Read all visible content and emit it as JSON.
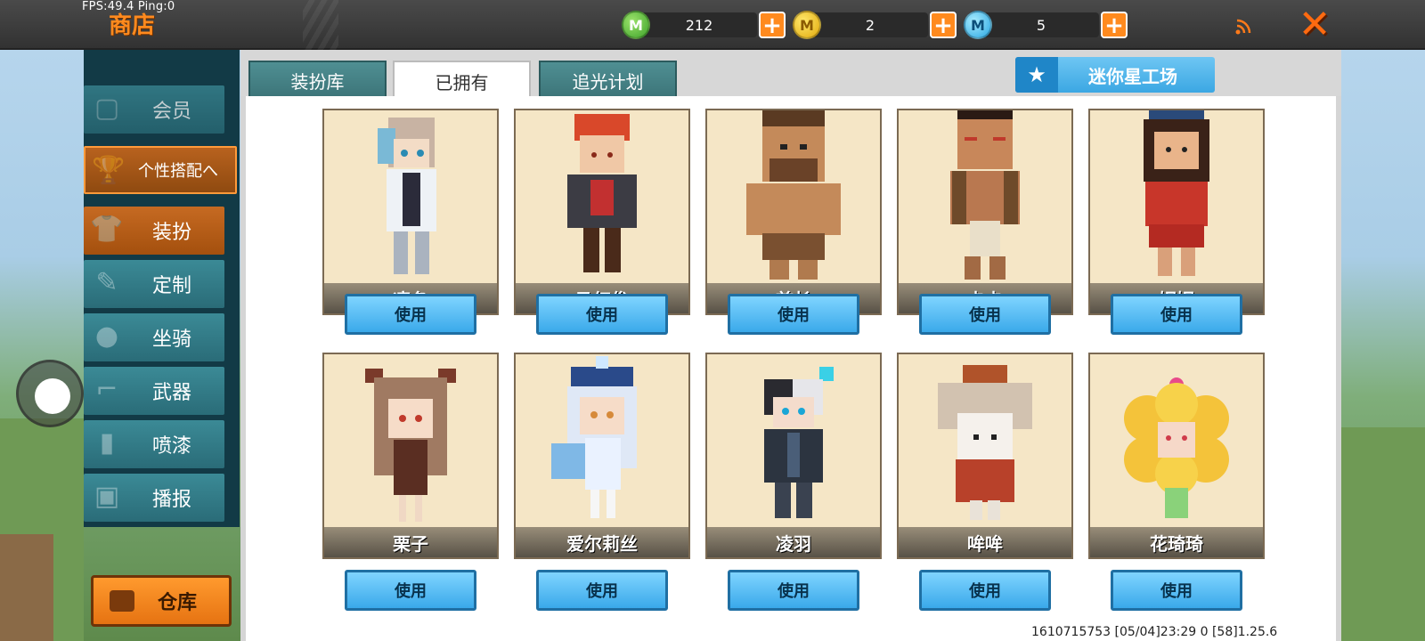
{
  "status": {
    "fps": "FPS:49.4",
    "ping": "Ping:0"
  },
  "header": {
    "title": "商店"
  },
  "currencies": [
    {
      "icon": "green-mini-coin-icon",
      "symbol": "M",
      "amount": "212"
    },
    {
      "icon": "gold-coin-icon",
      "symbol": "M",
      "amount": "2"
    },
    {
      "icon": "blue-mini-bean-icon",
      "symbol": "M",
      "amount": "5"
    }
  ],
  "plus_label": "+",
  "close_label": "✕",
  "sidebar": {
    "items": [
      {
        "label": "会员",
        "icon": "member-icon"
      },
      {
        "label": "个性搭配へ",
        "icon": "trophy-icon"
      },
      {
        "label": "装扮",
        "icon": "shirt-icon"
      },
      {
        "label": "定制",
        "icon": "pencil-icon"
      },
      {
        "label": "坐骑",
        "icon": "footprint-icon"
      },
      {
        "label": "武器",
        "icon": "gun-icon"
      },
      {
        "label": "喷漆",
        "icon": "spray-icon"
      },
      {
        "label": "播报",
        "icon": "gift-icon"
      }
    ],
    "warehouse_label": "仓库"
  },
  "tabs": [
    {
      "label": "装扮库"
    },
    {
      "label": "已拥有"
    },
    {
      "label": "追光计划"
    }
  ],
  "workshop": {
    "label": "迷你星工场"
  },
  "characters": [
    {
      "name": "凛冬",
      "use": "使用"
    },
    {
      "name": "马红俊",
      "use": "使用"
    },
    {
      "name": "酋长",
      "use": "使用"
    },
    {
      "name": "卡卡",
      "use": "使用"
    },
    {
      "name": "妮妮",
      "use": "使用"
    },
    {
      "name": "栗子",
      "use": "使用"
    },
    {
      "name": "爱尔莉丝",
      "use": "使用"
    },
    {
      "name": "凌羽",
      "use": "使用"
    },
    {
      "name": "哞哞",
      "use": "使用"
    },
    {
      "name": "花琦琦",
      "use": "使用"
    }
  ],
  "footer": {
    "info": "1610715753    [05/04]23:29 0   [58]1.25.6"
  },
  "colors": {
    "accent_orange": "#ff8a1e",
    "tab_teal": "#4f8f93",
    "use_button_blue": "#3aa9ea",
    "card_bg": "#f5e6c6"
  }
}
